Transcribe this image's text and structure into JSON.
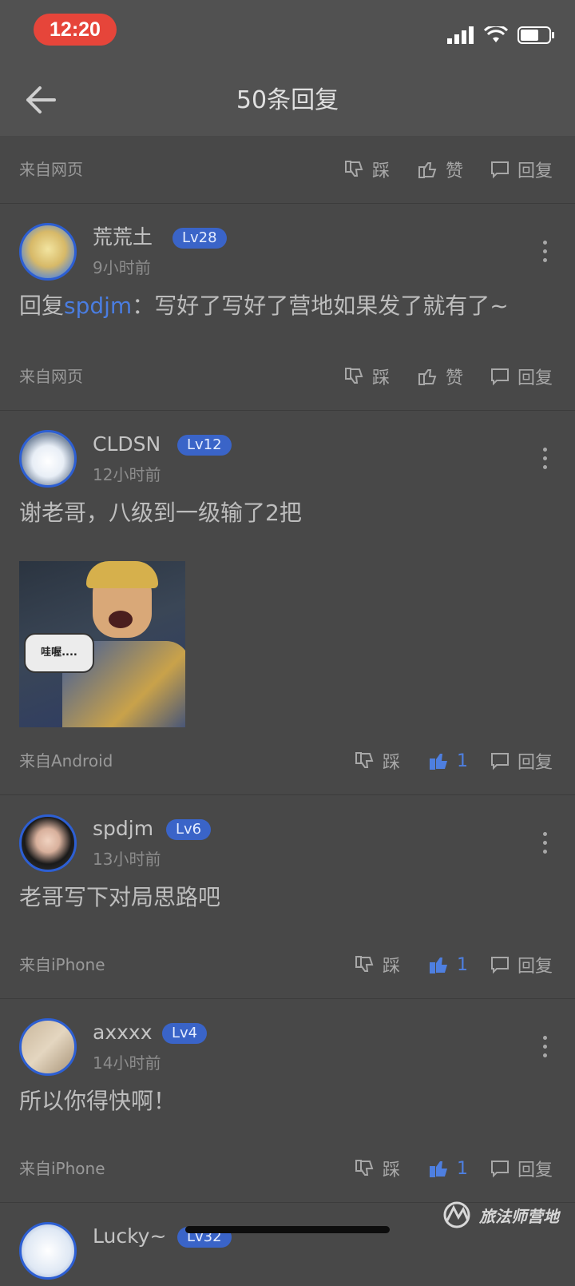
{
  "status_bar": {
    "time": "12:20"
  },
  "header": {
    "title": "50条回复"
  },
  "top_actions": {
    "source": "来自网页",
    "dislike": "踩",
    "like": "赞",
    "reply": "回复"
  },
  "posts": [
    {
      "username": "荒荒土",
      "level": "Lv28",
      "time": "9小时前",
      "content_prefix": "回复",
      "mention": "spdjm",
      "content_suffix": "：写好了写好了营地如果发了就有了~",
      "source": "来自网页",
      "dislike": "踩",
      "like": "赞",
      "reply": "回复"
    },
    {
      "username": "CLDSN",
      "level": "Lv12",
      "time": "12小时前",
      "content": "谢老哥，八级到一级输了2把",
      "image_text": "哇喔....",
      "source": "来自Android",
      "dislike": "踩",
      "like_count": "1",
      "reply": "回复"
    },
    {
      "username": "spdjm",
      "level": "Lv6",
      "time": "13小时前",
      "content": "老哥写下对局思路吧",
      "source": "来自iPhone",
      "dislike": "踩",
      "like_count": "1",
      "reply": "回复"
    },
    {
      "username": "axxxx",
      "level": "Lv4",
      "time": "14小时前",
      "content": "所以你得快啊！",
      "source": "来自iPhone",
      "dislike": "踩",
      "like_count": "1",
      "reply": "回复"
    },
    {
      "username": "Lucky~",
      "level": "Lv32"
    }
  ],
  "watermark": {
    "text": "旅法师营地"
  },
  "colors": {
    "accent": "#3a64c8",
    "time_pill": "#e6453a",
    "background": "#484848"
  }
}
